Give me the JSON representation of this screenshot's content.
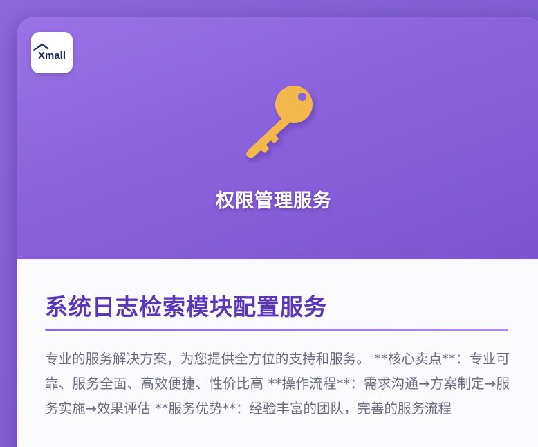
{
  "header": {
    "logo_text": "Xmall",
    "badge_title": "权限管理服务"
  },
  "service": {
    "title": "系统日志检索模块配置服务",
    "description": "专业的服务解决方案，为您提供全方位的支持和服务。 **核心卖点**：专业可靠、服务全面、高效便捷、性价比高 **操作流程**：需求沟通→方案制定→服务实施→效果评估 **服务优势**：经验丰富的团队，完善的服务流程"
  },
  "colors": {
    "accent": "#7d55d2",
    "title": "#5a36b8",
    "key": "#f2b84b"
  },
  "icons": {
    "hero": "key-icon",
    "brand": "xmall-logo-icon"
  }
}
